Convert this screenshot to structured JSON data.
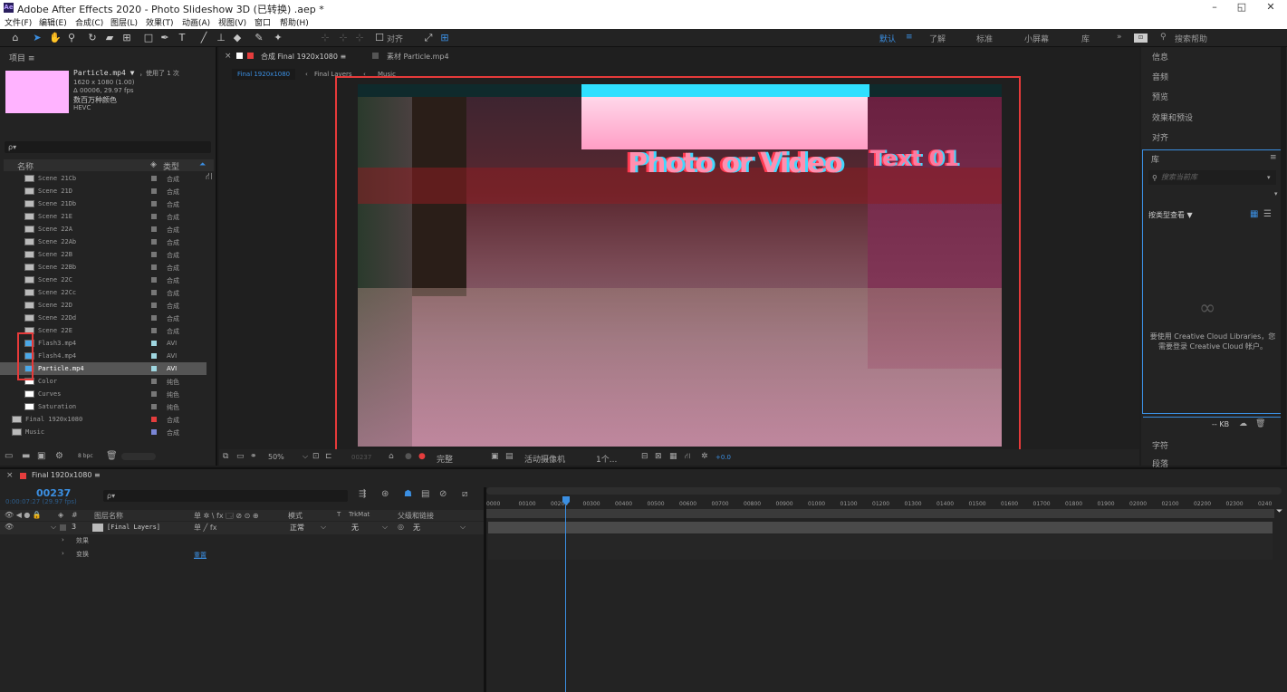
{
  "window": {
    "logo": "Ae",
    "title": "Adobe After Effects 2020 - Photo Slideshow 3D (已转换) .aep *",
    "minimize": "–",
    "maximize": "◱",
    "close": "✕"
  },
  "menu": [
    "文件(F)",
    "编辑(E)",
    "合成(C)",
    "图层(L)",
    "效果(T)",
    "动画(A)",
    "视图(V)",
    "窗口",
    "帮助(H)"
  ],
  "toolbar": {
    "align_label": "对齐",
    "workspaces": [
      "默认",
      "了解",
      "标准",
      "小屏幕",
      "库"
    ],
    "more": "»",
    "search_placeholder": "搜索帮助"
  },
  "project": {
    "title": "项目 ≡",
    "selected_name": "Particle.mp4 ▼",
    "used_count": "，使用了 1 次",
    "meta1": "1620 x 1080 (1.00)",
    "meta2": "Δ 00006, 29.97 fps",
    "meta3": "数百万种颜色",
    "meta4": "HEVC",
    "search_placeholder": "ρ▾",
    "col_name": "名称",
    "col_type": "类型",
    "bpc": "8 bpc",
    "items": [
      {
        "name": "Scene 21Cb",
        "type": "合成"
      },
      {
        "name": "Scene 21D",
        "type": "合成"
      },
      {
        "name": "Scene 21Db",
        "type": "合成"
      },
      {
        "name": "Scene 21E",
        "type": "合成"
      },
      {
        "name": "Scene 22A",
        "type": "合成"
      },
      {
        "name": "Scene 22Ab",
        "type": "合成"
      },
      {
        "name": "Scene 22B",
        "type": "合成"
      },
      {
        "name": "Scene 22Bb",
        "type": "合成"
      },
      {
        "name": "Scene 22C",
        "type": "合成"
      },
      {
        "name": "Scene 22Cc",
        "type": "合成"
      },
      {
        "name": "Scene 22D",
        "type": "合成"
      },
      {
        "name": "Scene 22Dd",
        "type": "合成"
      },
      {
        "name": "Scene 22E",
        "type": "合成"
      },
      {
        "name": "Flash3.mp4",
        "type": "AVI"
      },
      {
        "name": "Flash4.mp4",
        "type": "AVI"
      },
      {
        "name": "Particle.mp4",
        "type": "AVI"
      },
      {
        "name": "Color",
        "type": "纯色"
      },
      {
        "name": "Curves",
        "type": "纯色"
      },
      {
        "name": "Saturation",
        "type": "纯色"
      },
      {
        "name": "Final 1920x1080",
        "type": "合成"
      },
      {
        "name": "Music",
        "type": "合成"
      }
    ]
  },
  "comp": {
    "tab_label": "合成 Final 1920x1080 ≡",
    "footage_tab": "素材 Particle.mp4",
    "crumbs": [
      "Final 1920x1080",
      "Final Layers",
      "Music"
    ],
    "zoom": "50%",
    "timecode": "00237",
    "quality": "完整",
    "camera": "活动摄像机",
    "views": "1个...",
    "offset": "+0.0",
    "frame_text_1": "Photo or Video",
    "frame_text_2": "Text 01"
  },
  "right_panel": {
    "items": [
      "信息",
      "音频",
      "预览",
      "效果和预设",
      "对齐"
    ],
    "library_title": "库",
    "library_search": "搜索当前库",
    "view_by": "按类型查看 ▼",
    "signin_text": "要使用 Creative Cloud Libraries，您需要登录 Creative Cloud 帐户。",
    "kb": "-- KB",
    "char_label": "字符",
    "para_label": "段落"
  },
  "timeline": {
    "tab_label": "Final 1920x1080 ≡",
    "timecode": "00237",
    "timecode_sub": "0:00:07:27 (29.97 fps)",
    "search_placeholder": "ρ▾",
    "col_num": "#",
    "col_layer": "图层名称",
    "col_switches": "单 ✲ \\ fx 🗔 ⊘ ⊙ ⊕",
    "col_mode": "模式",
    "col_t": "T",
    "col_trkmat": "TrkMat",
    "col_parent": "父级和链接",
    "layer_num": "3",
    "layer_name": "[Final Layers]",
    "layer_mode": "正常",
    "layer_trk": "无",
    "layer_parent": "无",
    "sub_effects": "效果",
    "sub_transform": "变换",
    "reset": "重置",
    "ruler": [
      "0000",
      "00100",
      "00200",
      "00300",
      "00400",
      "00500",
      "00600",
      "00700",
      "00800",
      "00900",
      "01000",
      "01100",
      "01200",
      "01300",
      "01400",
      "01500",
      "01600",
      "01700",
      "01800",
      "01900",
      "02000",
      "02100",
      "02200",
      "02300",
      "0240"
    ]
  },
  "colors": {
    "accent": "#3b8fe2",
    "highlight": "#e63a3a",
    "thumb": "#ffb3ff"
  }
}
